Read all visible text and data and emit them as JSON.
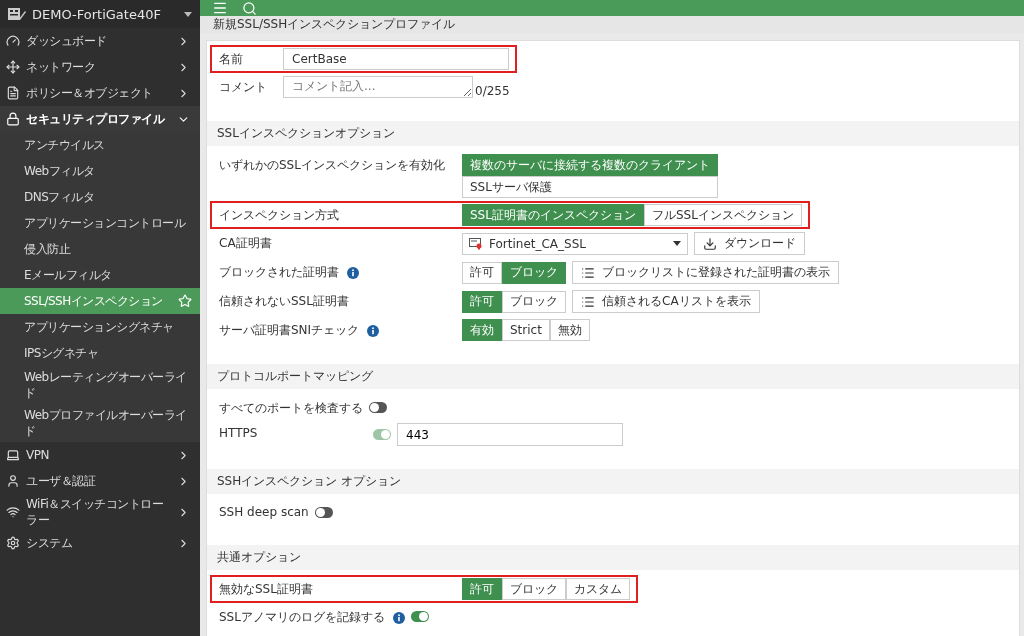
{
  "sidebar": {
    "device": {
      "name": "DEMO-FortiGate40F"
    },
    "items": [
      {
        "label": "ダッシュボード",
        "expanded": false
      },
      {
        "label": "ネットワーク",
        "expanded": false
      },
      {
        "label": "ポリシー＆オブジェクト",
        "expanded": false
      },
      {
        "label": "セキュリティプロファイル",
        "expanded": true,
        "children": [
          {
            "label": "アンチウイルス",
            "selected": false
          },
          {
            "label": "Webフィルタ",
            "selected": false
          },
          {
            "label": "DNSフィルタ",
            "selected": false
          },
          {
            "label": "アプリケーションコントロール",
            "selected": false
          },
          {
            "label": "侵入防止",
            "selected": false
          },
          {
            "label": "Eメールフィルタ",
            "selected": false
          },
          {
            "label": "SSL/SSHインスペクション",
            "selected": true
          },
          {
            "label": "アプリケーションシグネチャ",
            "selected": false
          },
          {
            "label": "IPSシグネチャ",
            "selected": false
          },
          {
            "label": "Webレーティングオーバーライド",
            "selected": false
          },
          {
            "label": "Webプロファイルオーバーライド",
            "selected": false
          }
        ]
      },
      {
        "label": "VPN",
        "expanded": false
      },
      {
        "label": "ユーザ＆認証",
        "expanded": false
      },
      {
        "label": "WiFi＆スイッチコントローラー",
        "expanded": false
      },
      {
        "label": "システム",
        "expanded": false
      }
    ]
  },
  "page_title": "新規SSL/SSHインスペクションプロファイル",
  "sections": [
    {
      "rows": [
        {
          "kind": "text",
          "label": "名前",
          "value": "CertBase",
          "highlighted": true
        },
        {
          "kind": "textarea",
          "label": "コメント",
          "placeholder": "コメント記入...",
          "counter": "0/255",
          "highlighted": false
        }
      ]
    },
    {
      "title": "SSLインスペクションオプション",
      "rows": [
        {
          "kind": "stack",
          "label": "いずれかのSSLインスペクションを有効化",
          "highlighted": false,
          "options": [
            {
              "label": "複数のサーバに接続する複数のクライアント",
              "selected": true
            },
            {
              "label": "SSLサーバ保護",
              "selected": false
            }
          ]
        },
        {
          "kind": "choice",
          "label": "インスペクション方式",
          "highlighted": true,
          "info": false,
          "options": [
            {
              "label": "SSL証明書のインスペクション",
              "selected": true
            },
            {
              "label": "フルSSLインスペクション",
              "selected": false
            }
          ]
        },
        {
          "kind": "select",
          "label": "CA証明書",
          "highlighted": false,
          "value": "Fortinet_CA_SSL",
          "button": "ダウンロード"
        },
        {
          "kind": "choice",
          "label": "ブロックされた証明書",
          "highlighted": false,
          "info": true,
          "options": [
            {
              "label": "許可",
              "selected": false
            },
            {
              "label": "ブロック",
              "selected": true
            }
          ],
          "button": "ブロックリストに登録された証明書の表示"
        },
        {
          "kind": "choice",
          "label": "信頼されないSSL証明書",
          "highlighted": false,
          "info": false,
          "options": [
            {
              "label": "許可",
              "selected": true
            },
            {
              "label": "ブロック",
              "selected": false
            }
          ],
          "button": "信頼されるCAリストを表示"
        },
        {
          "kind": "choice",
          "label": "サーバ証明書SNIチェック",
          "highlighted": false,
          "info": true,
          "options": [
            {
              "label": "有効",
              "selected": true
            },
            {
              "label": "Strict",
              "selected": false
            },
            {
              "label": "無効",
              "selected": false
            }
          ]
        }
      ]
    },
    {
      "title": "プロトコルポートマッピング",
      "rows": [
        {
          "kind": "toggle",
          "label": "すべてのポートを検査する",
          "highlighted": false,
          "info": false,
          "on": false,
          "disabled": false
        },
        {
          "kind": "port",
          "label": "HTTPS",
          "highlighted": false,
          "on": true,
          "disabled": true,
          "value": "443"
        }
      ]
    },
    {
      "title": "SSHインスペクション オプション",
      "rows": [
        {
          "kind": "toggle",
          "label": "SSH deep scan",
          "highlighted": false,
          "info": false,
          "on": false,
          "disabled": false
        }
      ]
    },
    {
      "title": "共通オプション",
      "rows": [
        {
          "kind": "choice",
          "label": "無効なSSL証明書",
          "highlighted": true,
          "info": false,
          "options": [
            {
              "label": "許可",
              "selected": true
            },
            {
              "label": "ブロック",
              "selected": false
            },
            {
              "label": "カスタム",
              "selected": false
            }
          ]
        },
        {
          "kind": "toggle",
          "label": "SSLアノマリのログを記録する",
          "highlighted": false,
          "info": true,
          "on": true,
          "disabled": false
        }
      ]
    }
  ]
}
